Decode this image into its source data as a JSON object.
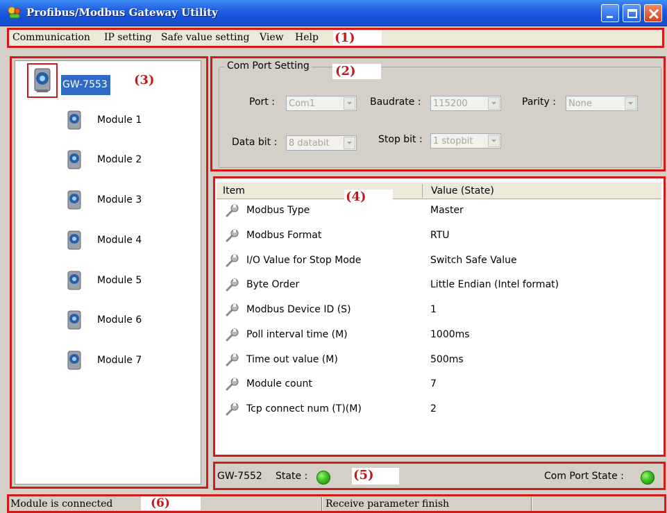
{
  "window": {
    "title": "Profibus/Modbus Gateway Utility"
  },
  "menu": {
    "items": [
      "Communication",
      "IP setting",
      "Safe value setting",
      "View",
      "Help"
    ]
  },
  "markers": [
    "(1)",
    "(2)",
    "(3)",
    "(4)",
    "(5)",
    "(6)"
  ],
  "tree": {
    "root": "GW-7553",
    "modules": [
      "Module 1",
      "Module 2",
      "Module 3",
      "Module 4",
      "Module 5",
      "Module 6",
      "Module 7"
    ]
  },
  "com_port": {
    "group_title": "Com Port Setting",
    "port_label": "Port :",
    "port_value": "Com1",
    "baudrate_label": "Baudrate :",
    "baudrate_value": "115200",
    "parity_label": "Parity :",
    "parity_value": "None",
    "databit_label": "Data bit :",
    "databit_value": "8 databit",
    "stopbit_label": "Stop bit :",
    "stopbit_value": "1 stopbit"
  },
  "table": {
    "headers": [
      "Item",
      "Value (State)"
    ],
    "rows": [
      {
        "item": "Modbus Type",
        "value": "Master"
      },
      {
        "item": "Modbus Format",
        "value": "RTU"
      },
      {
        "item": "I/O Value for Stop Mode",
        "value": "Switch Safe Value"
      },
      {
        "item": "Byte Order",
        "value": "Little Endian (Intel format)"
      },
      {
        "item": "Modbus Device ID (S)",
        "value": "1"
      },
      {
        "item": "Poll interval time (M)",
        "value": "1000ms"
      },
      {
        "item": "Time out value (M)",
        "value": "500ms"
      },
      {
        "item": "Module count",
        "value": "7"
      },
      {
        "item": "Tcp connect num (T)(M)",
        "value": "2"
      }
    ]
  },
  "device_status": {
    "device": "GW-7552",
    "state_label": "State :",
    "state_color": "#3cc21c",
    "com_state_label": "Com Port State :",
    "com_state_color": "#3cc21c"
  },
  "statusbar": {
    "left": "Module is connected",
    "middle": "Receive parameter finish",
    "right": ""
  }
}
